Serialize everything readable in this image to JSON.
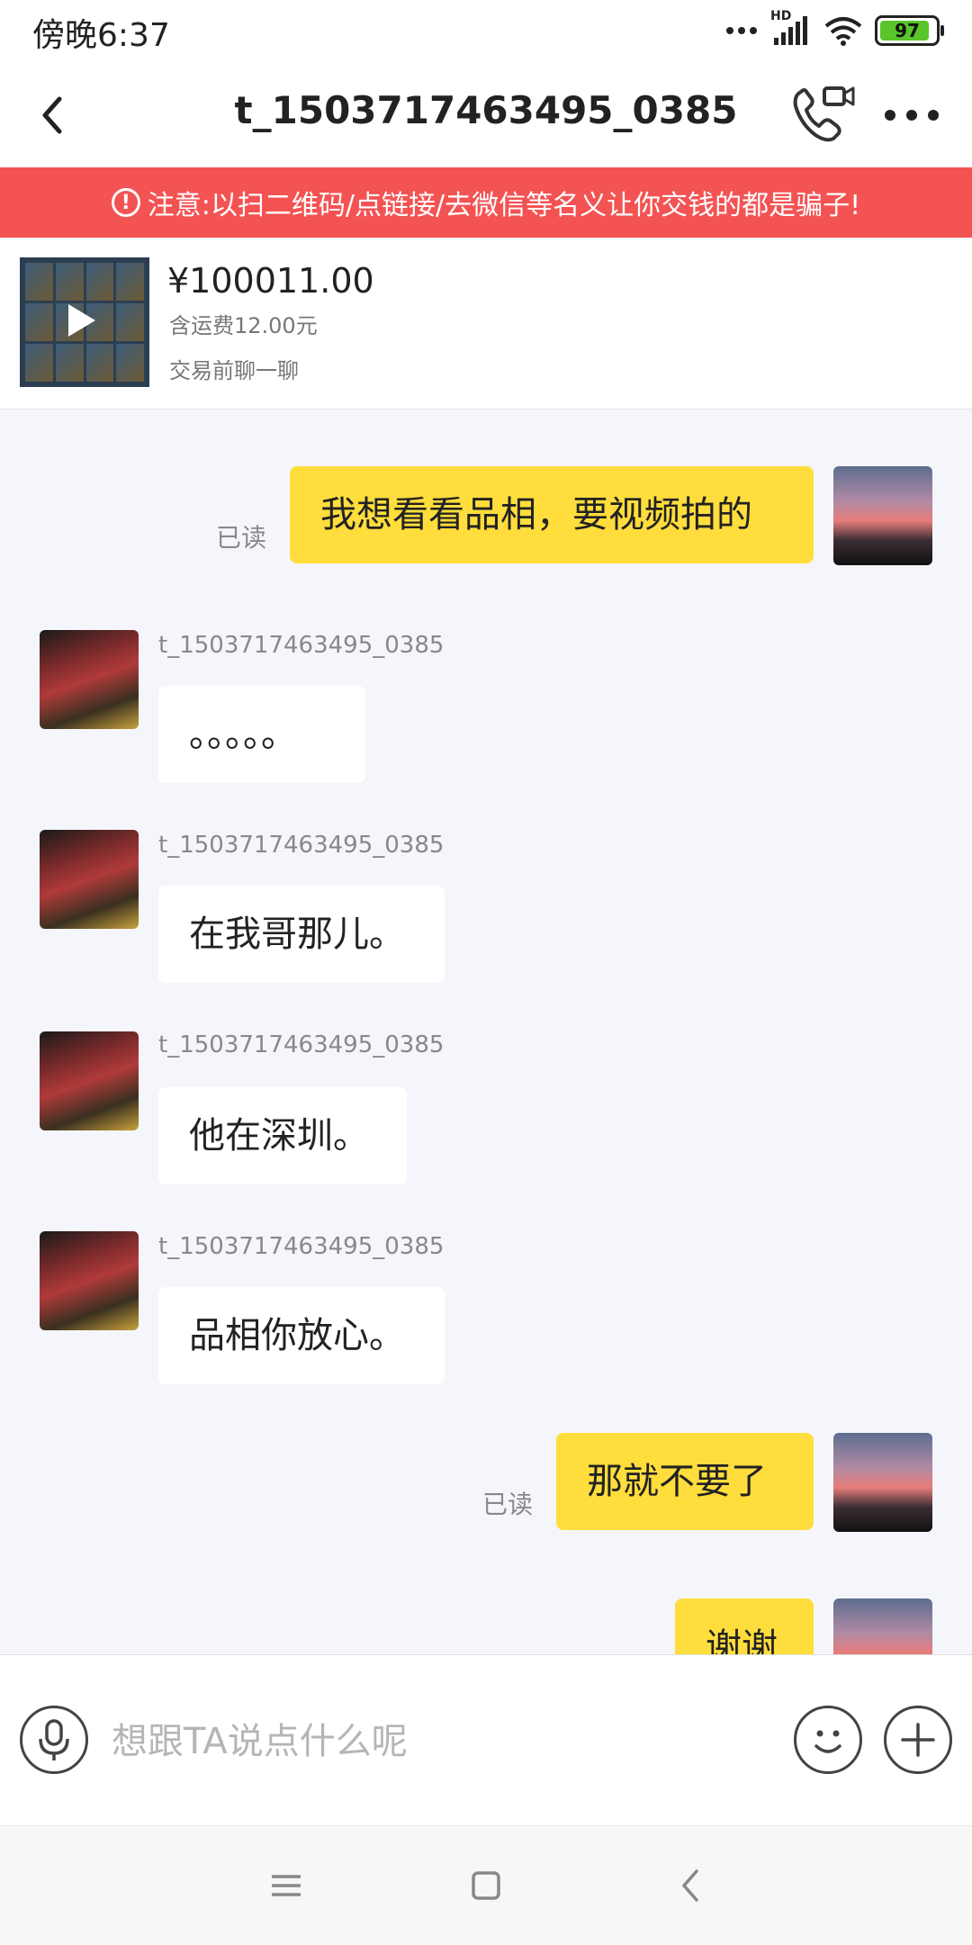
{
  "status_bar": {
    "time": "傍晚6:37",
    "network_label": "HD",
    "battery": "97"
  },
  "header": {
    "title": "t_1503717463495_0385"
  },
  "warning": {
    "text": "注意:以扫二维码/点链接/去微信等名义让你交钱的都是骗子!"
  },
  "product": {
    "price": "¥100011.00",
    "shipping": "含运费12.00元",
    "chat_hint": "交易前聊一聊"
  },
  "messages": [
    {
      "side": "me",
      "text": "我想看看品相，要视频拍的",
      "status": "已读"
    },
    {
      "side": "them",
      "sender": "t_1503717463495_0385",
      "text": "。。。。。"
    },
    {
      "side": "them",
      "sender": "t_1503717463495_0385",
      "text": "在我哥那儿。"
    },
    {
      "side": "them",
      "sender": "t_1503717463495_0385",
      "text": "他在深圳。"
    },
    {
      "side": "them",
      "sender": "t_1503717463495_0385",
      "text": "品相你放心。"
    },
    {
      "side": "me",
      "text": "那就不要了",
      "status": "已读"
    },
    {
      "side": "me",
      "text": "谢谢"
    }
  ],
  "input": {
    "placeholder": "想跟TA说点什么呢"
  },
  "icons": {
    "back": "back-arrow-icon",
    "call": "phone-video-icon",
    "more": "more-dots-icon",
    "warning": "warning-icon",
    "mic": "microphone-icon",
    "emoji": "emoji-icon",
    "plus": "plus-icon"
  },
  "colors": {
    "warning_bg": "#f45353",
    "my_bubble": "#ffdd3c",
    "their_bubble": "#ffffff",
    "chat_bg": "#f5f6fb"
  }
}
